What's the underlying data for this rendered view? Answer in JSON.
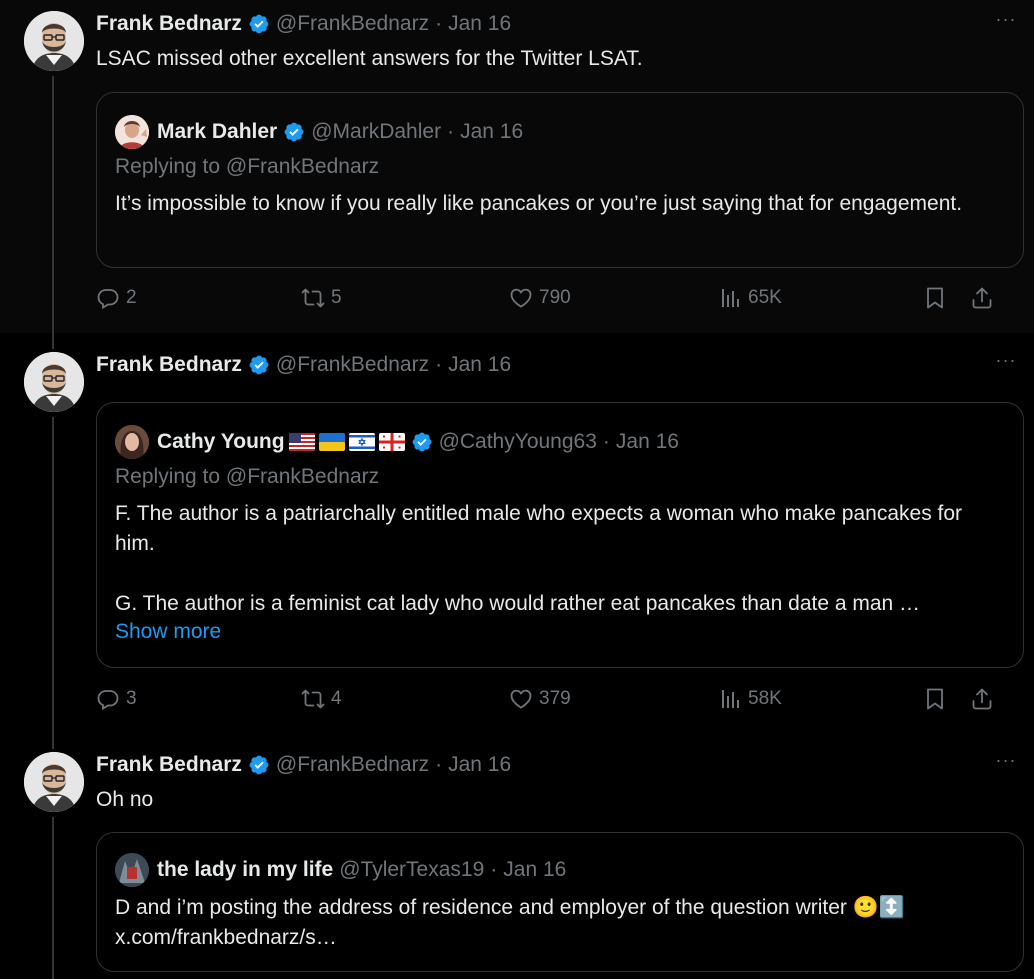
{
  "colors": {
    "accent": "#1d9bf0",
    "muted": "#71767b",
    "text": "#e7e9ea",
    "border": "#2f3336"
  },
  "tweets": [
    {
      "author": {
        "name": "Frank Bednarz",
        "handle": "@FrankBednarz",
        "date": "Jan 16",
        "verified": true
      },
      "text": "LSAC missed other excellent answers for the Twitter LSAT.",
      "quote": {
        "author": {
          "name": "Mark Dahler",
          "handle": "@MarkDahler",
          "date": "Jan 16",
          "verified": true
        },
        "replying_prefix": "Replying to ",
        "replying_to": "@FrankBednarz",
        "text": "It’s impossible to know if you really like pancakes or you’re just saying that for engagement."
      },
      "stats": {
        "replies": "2",
        "reposts": "5",
        "likes": "790",
        "views": "65K"
      }
    },
    {
      "author": {
        "name": "Frank Bednarz",
        "handle": "@FrankBednarz",
        "date": "Jan 16",
        "verified": true
      },
      "quote": {
        "author": {
          "name": "Cathy Young",
          "handle": "@CathyYoung63",
          "date": "Jan 16",
          "verified": true,
          "flags": [
            "us-flag",
            "ukraine-flag",
            "israel-flag",
            "georgia-flag"
          ]
        },
        "replying_prefix": "Replying to ",
        "replying_to": "@FrankBednarz",
        "text_1": "F. The author is a patriarchally entitled male who expects a woman who make pancakes for him.",
        "text_2": "G. The author is a feminist cat lady who would rather eat pancakes than date a man …",
        "show_more": "Show more"
      },
      "stats": {
        "replies": "3",
        "reposts": "4",
        "likes": "379",
        "views": "58K"
      }
    },
    {
      "author": {
        "name": "Frank Bednarz",
        "handle": "@FrankBednarz",
        "date": "Jan 16",
        "verified": true
      },
      "text": "Oh no",
      "quote": {
        "author": {
          "name": "the lady in my life",
          "handle": "@TylerTexas19",
          "date": "Jan 16",
          "verified": false
        },
        "text": "D and i’m posting the address of residence and employer of the question writer 🙂↕️",
        "link": "x.com/frankbednarz/s…"
      }
    }
  ],
  "ui": {
    "dot_sep": "·",
    "more": "···"
  }
}
